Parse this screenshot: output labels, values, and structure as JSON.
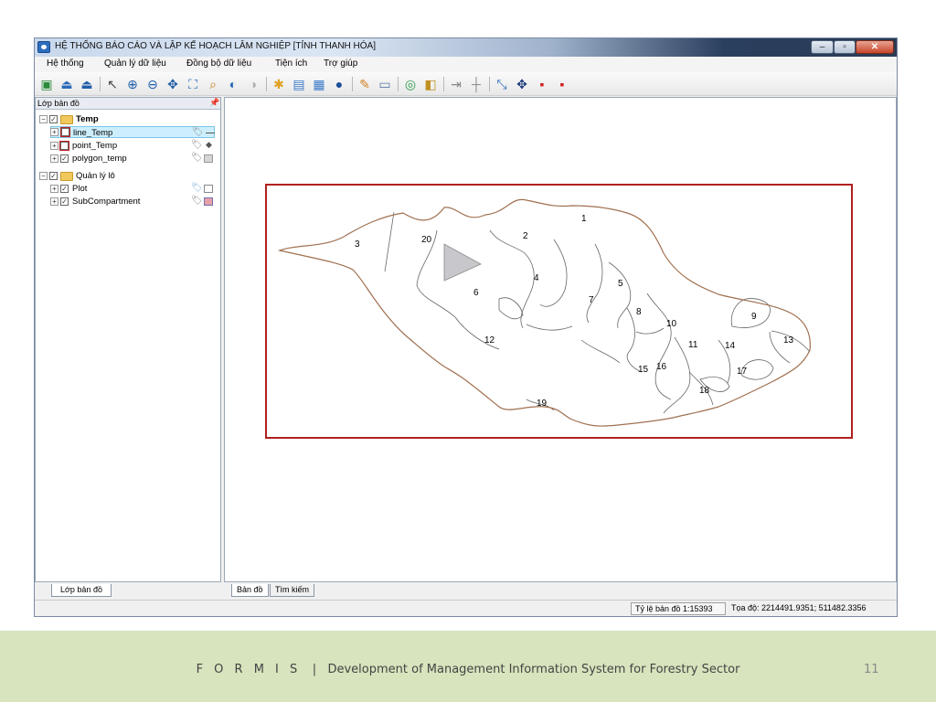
{
  "window": {
    "title": "HỆ THỐNG BÁO CÁO VÀ LẬP KẾ HOẠCH LÂM NGHIỆP [TỈNH THANH HÓA]"
  },
  "window_controls": {
    "minimize": "–",
    "maximize": "▫",
    "close": "✕"
  },
  "menu": [
    "Hệ thống",
    "Quản lý dữ liệu",
    "Đồng bộ dữ liệu",
    "Tiện ích",
    "Trợ giúp"
  ],
  "toolbar": [
    {
      "icon": "add-layer-icon",
      "glyph": "▣",
      "color": "#2a8a3a"
    },
    {
      "icon": "load-data-icon",
      "glyph": "⏏",
      "color": "#2a6ab8"
    },
    {
      "icon": "upload-icon",
      "glyph": "⏏",
      "color": "#1f5da8"
    },
    {
      "icon": "select-pointer-icon",
      "glyph": "↖",
      "color": "#444444"
    },
    {
      "icon": "zoom-in-icon",
      "glyph": "⊕",
      "color": "#1f5da8"
    },
    {
      "icon": "zoom-out-icon",
      "glyph": "⊖",
      "color": "#1f5da8"
    },
    {
      "icon": "pan-icon",
      "glyph": "✥",
      "color": "#1f5da8"
    },
    {
      "icon": "full-extent-icon",
      "glyph": "⛶",
      "color": "#2a6ab8"
    },
    {
      "icon": "zoom-layer-icon",
      "glyph": "⌕",
      "color": "#d08020"
    },
    {
      "icon": "previous-extent-icon",
      "glyph": "◐",
      "color": "#2a6ab8"
    },
    {
      "icon": "next-extent-icon",
      "glyph": "◑",
      "color": "#b0b0b0"
    },
    {
      "icon": "select-features-icon",
      "glyph": "✱",
      "color": "#e0a020"
    },
    {
      "icon": "clear-selection-icon",
      "glyph": "▤",
      "color": "#3a7ac8"
    },
    {
      "icon": "attribute-table-icon",
      "glyph": "▦",
      "color": "#3a7ac8"
    },
    {
      "icon": "identify-icon",
      "glyph": "●",
      "color": "#1f4f9a"
    },
    {
      "icon": "edit-pencil-icon",
      "glyph": "✎",
      "color": "#d08020"
    },
    {
      "icon": "edit-sketch-icon",
      "glyph": "▭",
      "color": "#5a7aa8"
    },
    {
      "icon": "merge-icon",
      "glyph": "◎",
      "color": "#2a9a4a"
    },
    {
      "icon": "split-icon",
      "glyph": "◧",
      "color": "#c09020"
    },
    {
      "icon": "measure-line-icon",
      "glyph": "⇥",
      "color": "#888888"
    },
    {
      "icon": "measure-cross-icon",
      "glyph": "┼",
      "color": "#888888"
    },
    {
      "icon": "edit-vertices-icon",
      "glyph": "⤡",
      "color": "#2a6ab8"
    },
    {
      "icon": "move-icon",
      "glyph": "✥",
      "color": "#1a3a7a"
    },
    {
      "icon": "add-point-icon",
      "glyph": "▪",
      "color": "#d02020"
    },
    {
      "icon": "delete-point-icon",
      "glyph": "▪",
      "color": "#d02020"
    }
  ],
  "layer_panel": {
    "title": "Lớp bản đồ",
    "groups": [
      {
        "label": "Temp",
        "checked": true,
        "layers": [
          {
            "label": "line_Temp",
            "checked": false,
            "highlighted": true,
            "symbol": "line"
          },
          {
            "label": "point_Temp",
            "checked": false,
            "symbol": "point"
          },
          {
            "label": "polygon_temp",
            "checked": true,
            "symbol": "polygon-gray"
          }
        ]
      },
      {
        "label": "Quản lý lô",
        "checked": true,
        "layers": [
          {
            "label": "Plot",
            "checked": true,
            "symbol": "polygon-white"
          },
          {
            "label": "SubCompartment",
            "checked": true,
            "symbol": "polygon-pink"
          }
        ]
      }
    ],
    "tab": "Lớp bản đồ"
  },
  "map_tabs": [
    "Bản đồ",
    "Tìm kiếm"
  ],
  "map": {
    "labels": [
      {
        "text": "1"
      },
      {
        "text": "2"
      },
      {
        "text": "3"
      },
      {
        "text": "4"
      },
      {
        "text": "5"
      },
      {
        "text": "6"
      },
      {
        "text": "7"
      },
      {
        "text": "8"
      },
      {
        "text": "9"
      },
      {
        "text": "10"
      },
      {
        "text": "11"
      },
      {
        "text": "12"
      },
      {
        "text": "13"
      },
      {
        "text": "14"
      },
      {
        "text": "15"
      },
      {
        "text": "16"
      },
      {
        "text": "17"
      },
      {
        "text": "18"
      },
      {
        "text": "19"
      },
      {
        "text": "20"
      }
    ],
    "boundary_color": "#a07050",
    "frame_color": "#b02020"
  },
  "status": {
    "scale": "Tỷ lệ bản đồ 1:15393",
    "coords": "Tọa độ: 2214491.9351; 511482.3356"
  },
  "footer": {
    "brand": "F O R M I S",
    "separator": "|",
    "text": "Development of Management Information System for Forestry Sector",
    "page": "11"
  }
}
